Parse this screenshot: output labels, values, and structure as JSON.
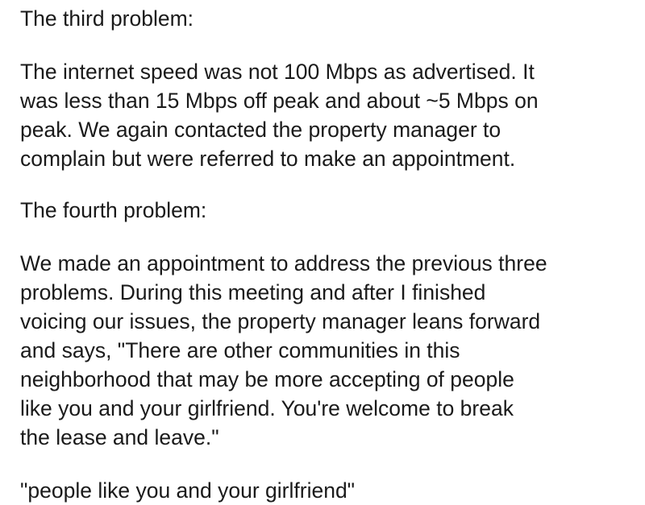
{
  "heading_1": "The third problem:",
  "paragraph_1": [
    "The internet speed was not 100 Mbps as advertised. It",
    "was less than 15 Mbps off peak and about ~5 Mbps on",
    "peak. We again contacted the property manager to",
    "complain but were referred to make an appointment."
  ],
  "heading_2": "The fourth problem:",
  "paragraph_2": [
    "We made an appointment to address the previous three",
    "problems. During this meeting and after I finished",
    "voicing our issues, the property manager leans forward",
    "and says, \"There are other communities in this",
    "neighborhood that may be more accepting of people",
    "like you and your girlfriend. You're welcome to break",
    "the lease and leave.\""
  ],
  "closing_quote": "\"people like you and your girlfriend\""
}
